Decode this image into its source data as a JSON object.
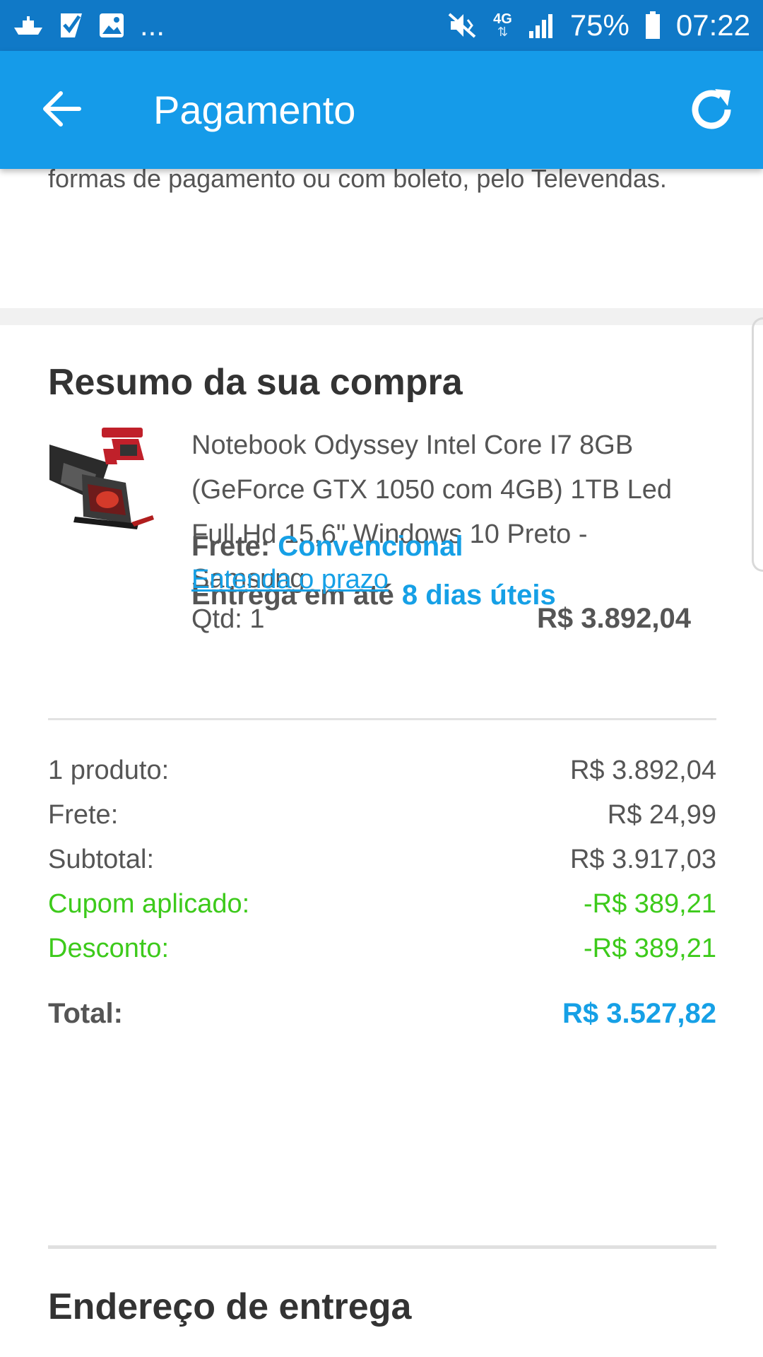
{
  "status_bar": {
    "dots": "...",
    "network": "4G",
    "battery": "75%",
    "time": "07:22"
  },
  "app_bar": {
    "title": "Pagamento",
    "back_icon": "arrow-left-icon",
    "refresh_icon": "refresh-icon"
  },
  "top_note": {
    "text": "formas de pagamento ou com boleto, pelo Televendas."
  },
  "summary": {
    "title": "Resumo da sua compra",
    "product": {
      "name": "Notebook Odyssey Intel Core I7 8GB (GeForce GTX 1050 com 4GB) 1TB Led Full Hd 15,6\" Windows 10 Preto - Samsung",
      "freight_label": "Frete:",
      "freight_type": "Convencional",
      "delivery_label": "Entrega em até",
      "delivery_value": "8 dias úteis",
      "link": "Entenda o prazo",
      "qty": "Qtd: 1",
      "price": "R$ 3.892,04"
    },
    "rows": [
      {
        "label": "1 produto:",
        "value": "R$ 3.892,04"
      },
      {
        "label": "Frete:",
        "value": "R$ 24,99"
      },
      {
        "label": "Subtotal:",
        "value": "R$ 3.917,03"
      },
      {
        "label": "Cupom aplicado:",
        "value": "-R$ 389,21"
      },
      {
        "label": "Desconto:",
        "value": "-R$ 389,21"
      }
    ],
    "total_label": "Total:",
    "total_value": "R$ 3.527,82"
  },
  "address": {
    "title": "Endereço de entrega"
  },
  "colors": {
    "status_bar": "#1079c7",
    "app_bar": "#159be9",
    "accent_blue": "#16a0e6",
    "discount_green": "#3dca1b"
  }
}
